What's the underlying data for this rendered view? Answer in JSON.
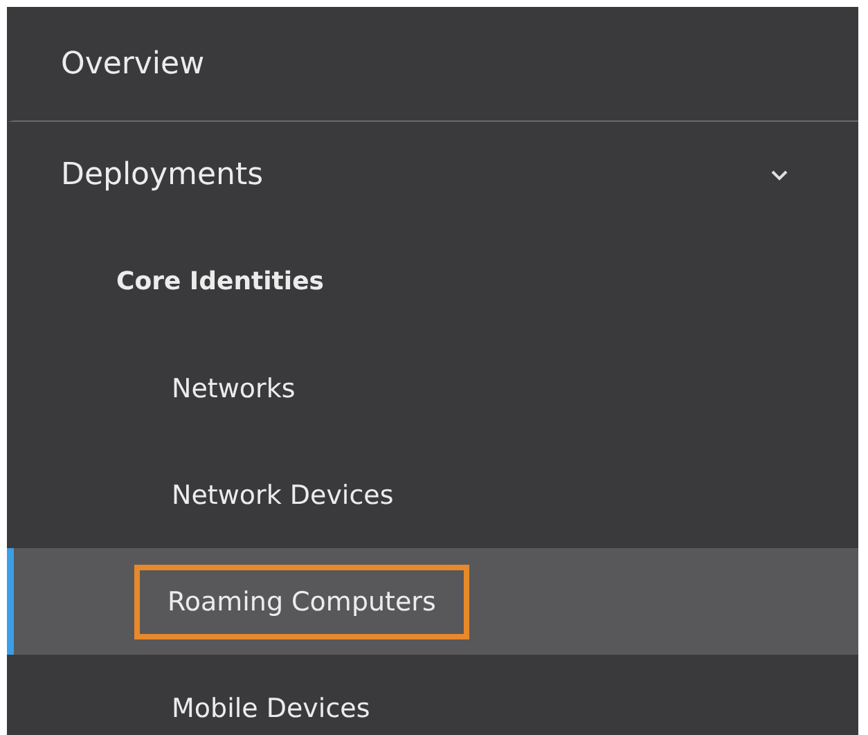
{
  "sidebar": {
    "items": [
      {
        "label": "Overview",
        "selected": false
      },
      {
        "label": "Deployments",
        "selected": false,
        "expanded": true,
        "children": [
          {
            "label": "Core Identities",
            "selected": false,
            "children": [
              {
                "label": "Networks",
                "selected": false
              },
              {
                "label": "Network Devices",
                "selected": false
              },
              {
                "label": "Roaming Computers",
                "selected": true
              },
              {
                "label": "Mobile Devices",
                "selected": false
              }
            ]
          }
        ]
      }
    ]
  }
}
